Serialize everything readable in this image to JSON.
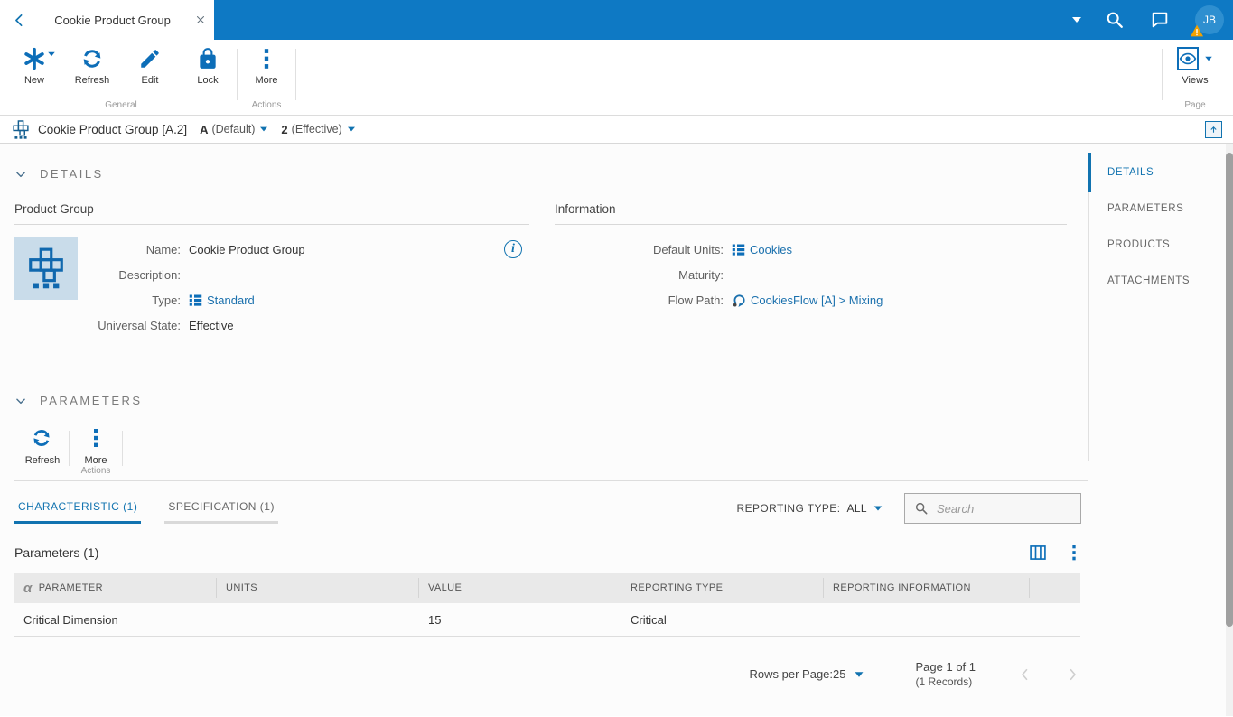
{
  "colors": {
    "topbar_blue": "#0e79c4",
    "icon_blue": "#0d6eb8",
    "link_blue": "#1a70ad",
    "active_blue": "#1173b0",
    "tile_bg": "#c9dcea",
    "table_header_bg": "#e9e9e9"
  },
  "topbar": {
    "tab_title": "Cookie Product Group",
    "avatar_initials": "JB"
  },
  "ribbon": {
    "new_label": "New",
    "refresh_label": "Refresh",
    "edit_label": "Edit",
    "lock_label": "Lock",
    "more_label": "More",
    "general_group_label": "General",
    "actions_group_label": "Actions",
    "views_label": "Views",
    "page_group_label": "Page"
  },
  "breadcrumb": {
    "title": "Cookie Product Group [A.2]",
    "version_letter": "A",
    "version_state": "(Default)",
    "revision_number": "2",
    "revision_state": "(Effective)"
  },
  "side_nav": {
    "items": [
      {
        "label": "DETAILS",
        "active": true
      },
      {
        "label": "PARAMETERS",
        "active": false
      },
      {
        "label": "PRODUCTS",
        "active": false
      },
      {
        "label": "ATTACHMENTS",
        "active": false
      }
    ]
  },
  "details": {
    "heading": "DETAILS",
    "product_group": {
      "heading": "Product Group",
      "fields": [
        {
          "label": "Name:",
          "value": "Cookie Product Group"
        },
        {
          "label": "Description:",
          "value": ""
        },
        {
          "label": "Type:",
          "value": "Standard"
        },
        {
          "label": "Universal State:",
          "value": "Effective"
        }
      ]
    },
    "information": {
      "heading": "Information",
      "fields": [
        {
          "label": "Default Units:",
          "value": "Cookies"
        },
        {
          "label": "Maturity:",
          "value": ""
        },
        {
          "label": "Flow Path:",
          "value": "CookiesFlow [A] > Mixing"
        }
      ]
    }
  },
  "parameters": {
    "heading": "PARAMETERS",
    "toolbar": {
      "refresh_label": "Refresh",
      "more_label": "More",
      "actions_group_label": "Actions"
    },
    "tabs": [
      {
        "label": "CHARACTERISTIC (1)",
        "active": true
      },
      {
        "label": "SPECIFICATION (1)",
        "active": false
      }
    ],
    "reporting_type_label": "REPORTING TYPE:",
    "reporting_type_value": "ALL",
    "search_placeholder": "Search",
    "table_title": "Parameters (1)",
    "table": {
      "columns": [
        "PARAMETER",
        "UNITS",
        "VALUE",
        "REPORTING TYPE",
        "REPORTING INFORMATION"
      ],
      "rows": [
        {
          "parameter": "Critical Dimension",
          "units": "",
          "value": "15",
          "reporting_type": "Critical",
          "reporting_information": ""
        }
      ]
    },
    "pagination": {
      "rows_per_page_label": "Rows per Page:",
      "rows_per_page_value": "25",
      "page_label": "Page 1 of 1",
      "records_label": "(1 Records)"
    }
  },
  "icons": {
    "alpha_glyph": "α",
    "info_glyph": "i",
    "names": [
      "back-icon",
      "close-icon",
      "search-icon",
      "comment-icon",
      "warning-icon",
      "asterisk-new-icon",
      "refresh-icon",
      "pencil-edit-icon",
      "lock-icon",
      "more-dots-icon",
      "eye-views-icon",
      "product-group-icon",
      "box-arrow-up-icon",
      "chevron-down-icon",
      "list-icon",
      "flow-icon",
      "info-icon",
      "columns-icon",
      "alpha-sort-icon",
      "chevron-left-icon",
      "chevron-right-icon"
    ]
  }
}
